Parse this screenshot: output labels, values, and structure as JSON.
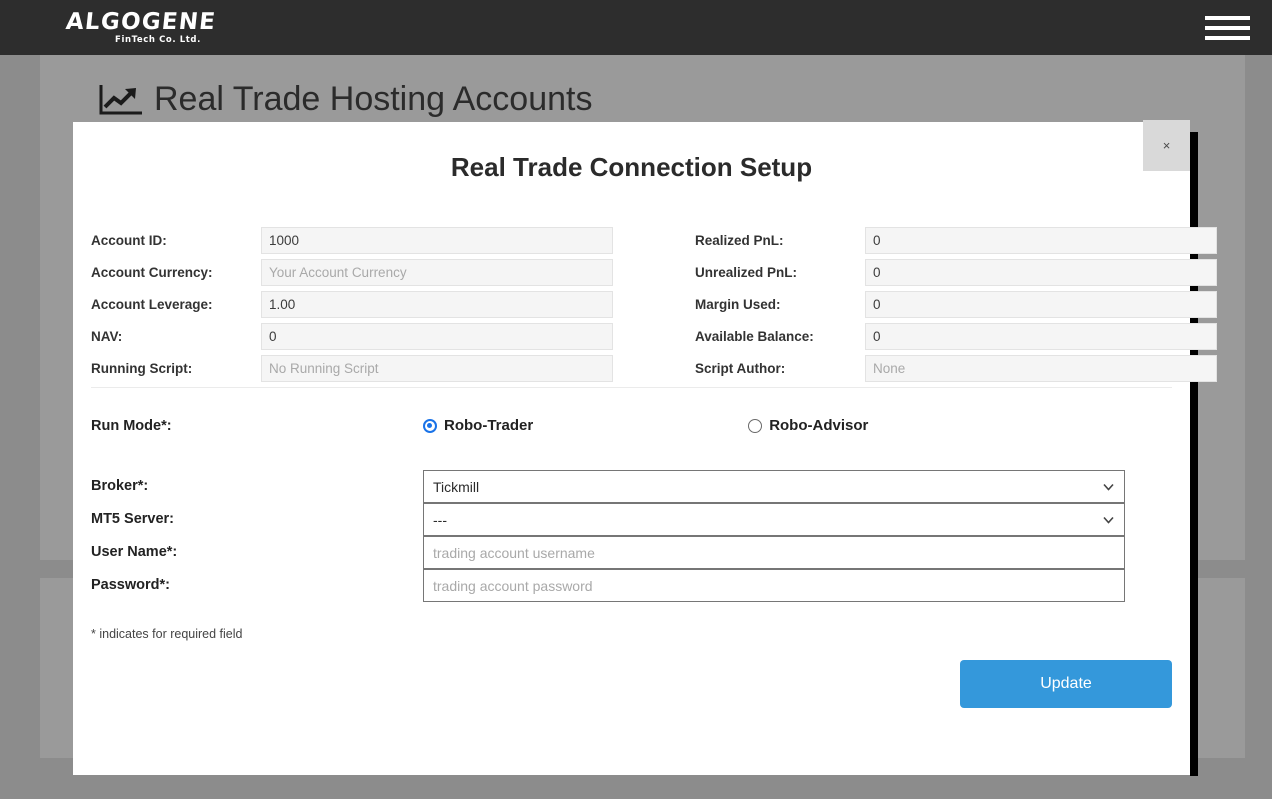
{
  "topbar": {
    "logo_main": "ALGOGENE",
    "logo_sub": "FinTech Co. Ltd.",
    "menu_icon": "hamburger-menu-icon"
  },
  "page": {
    "title": "Real Trade Hosting Accounts",
    "title_icon": "line-chart-up-icon"
  },
  "modal": {
    "title": "Real Trade Connection Setup",
    "close_label": "×",
    "account_info": {
      "left": [
        {
          "label": "Account ID:",
          "value": "1000",
          "is_placeholder": false
        },
        {
          "label": "Account Currency:",
          "value": "Your Account Currency",
          "is_placeholder": true
        },
        {
          "label": "Account Leverage:",
          "value": "1.00",
          "is_placeholder": false
        },
        {
          "label": "NAV:",
          "value": "0",
          "is_placeholder": false
        },
        {
          "label": "Running Script:",
          "value": "No Running Script",
          "is_placeholder": true
        }
      ],
      "right": [
        {
          "label": "Realized PnL:",
          "value": "0",
          "is_placeholder": false
        },
        {
          "label": "Unrealized PnL:",
          "value": "0",
          "is_placeholder": false
        },
        {
          "label": "Margin Used:",
          "value": "0",
          "is_placeholder": false
        },
        {
          "label": "Available Balance:",
          "value": "0",
          "is_placeholder": false
        },
        {
          "label": "Script Author:",
          "value": "None",
          "is_placeholder": true
        }
      ]
    },
    "run_mode": {
      "label": "Run Mode*:",
      "options": [
        {
          "label": "Robo-Trader",
          "selected": true
        },
        {
          "label": "Robo-Advisor",
          "selected": false
        }
      ]
    },
    "broker_form": {
      "broker": {
        "label": "Broker*:",
        "value": "Tickmill"
      },
      "mt5_server": {
        "label": "MT5 Server:",
        "value": "---"
      },
      "username": {
        "label": "User Name*:",
        "placeholder": "trading account username",
        "value": ""
      },
      "password": {
        "label": "Password*:",
        "placeholder": "trading account password",
        "value": ""
      }
    },
    "required_note": "* indicates for required field",
    "update_label": "Update"
  },
  "colors": {
    "topbar_bg": "#2d2d2d",
    "page_bg": "#8c8c8c",
    "panel_bg": "#9a9a9a",
    "modal_bg": "#ffffff",
    "accent_blue": "#3498db",
    "radio_blue": "#1a73e8",
    "input_bg": "#f5f5f5"
  }
}
